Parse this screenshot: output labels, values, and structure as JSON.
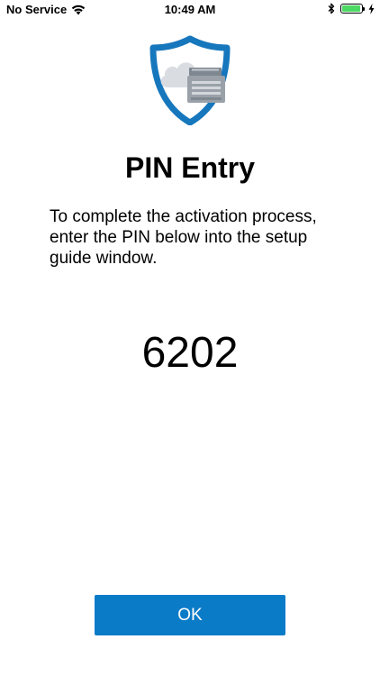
{
  "status_bar": {
    "carrier": "No Service",
    "time": "10:49 AM",
    "icons": [
      "wifi-icon",
      "bluetooth-icon",
      "battery-icon",
      "charging-icon"
    ],
    "battery_color": "#4cd964",
    "battery_level": 0.95
  },
  "logo": {
    "icon": "shield-cloud-printer-icon",
    "shield_color": "#1777bd",
    "cloud_color": "#d9dde2",
    "printer_color": "#9aa1a9"
  },
  "page": {
    "title": "PIN Entry",
    "instructions": "To complete the activation process, enter the PIN below into the setup guide window.",
    "pin": "6202"
  },
  "actions": {
    "ok_label": "OK",
    "ok_color": "#0a7bc7"
  }
}
